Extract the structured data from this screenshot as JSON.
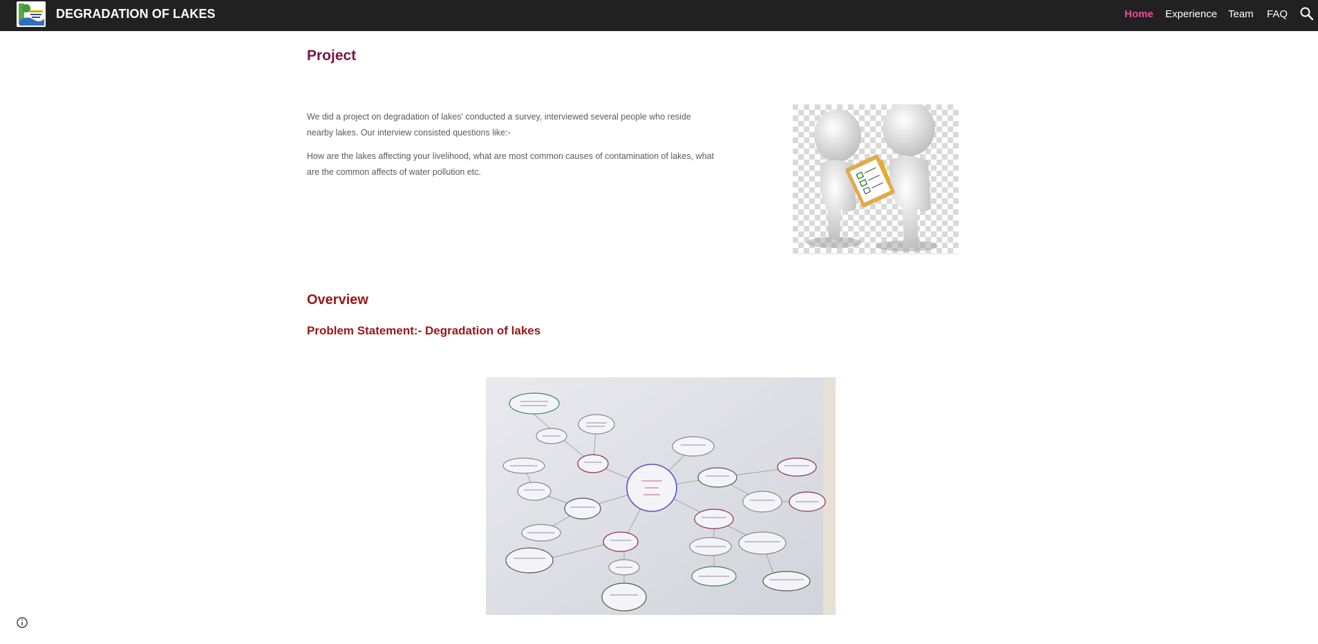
{
  "header": {
    "site_title": "DEGRADATION OF LAKES",
    "logo_icon": "lake-logo-icon",
    "nav": [
      {
        "label": "Home",
        "active": true
      },
      {
        "label": "Experience",
        "active": false
      },
      {
        "label": "Team",
        "active": false
      },
      {
        "label": "FAQ",
        "active": false
      }
    ],
    "search_icon": "search-icon"
  },
  "project": {
    "heading": "Project",
    "paragraphs": [
      "We did a project on degradation of lakes' conducted a survey, interviewed several people who reside nearby lakes. Our interview consisted questions like:-",
      "How are the lakes affecting your livelihood, what are most common causes of contamination of lakes, what are the common affects of water pollution etc."
    ],
    "image": "survey-illustration"
  },
  "overview": {
    "heading": "Overview",
    "problem_statement": "Problem Statement:- Degradation of lakes",
    "image": "mind-map-photo"
  },
  "footer": {
    "info_icon": "info-icon"
  },
  "colors": {
    "topbar": "#212121",
    "nav_active": "#f04a9a",
    "project_heading": "#7b1346",
    "overview_heading": "#9b1616",
    "body_text": "#5a5a5a"
  }
}
